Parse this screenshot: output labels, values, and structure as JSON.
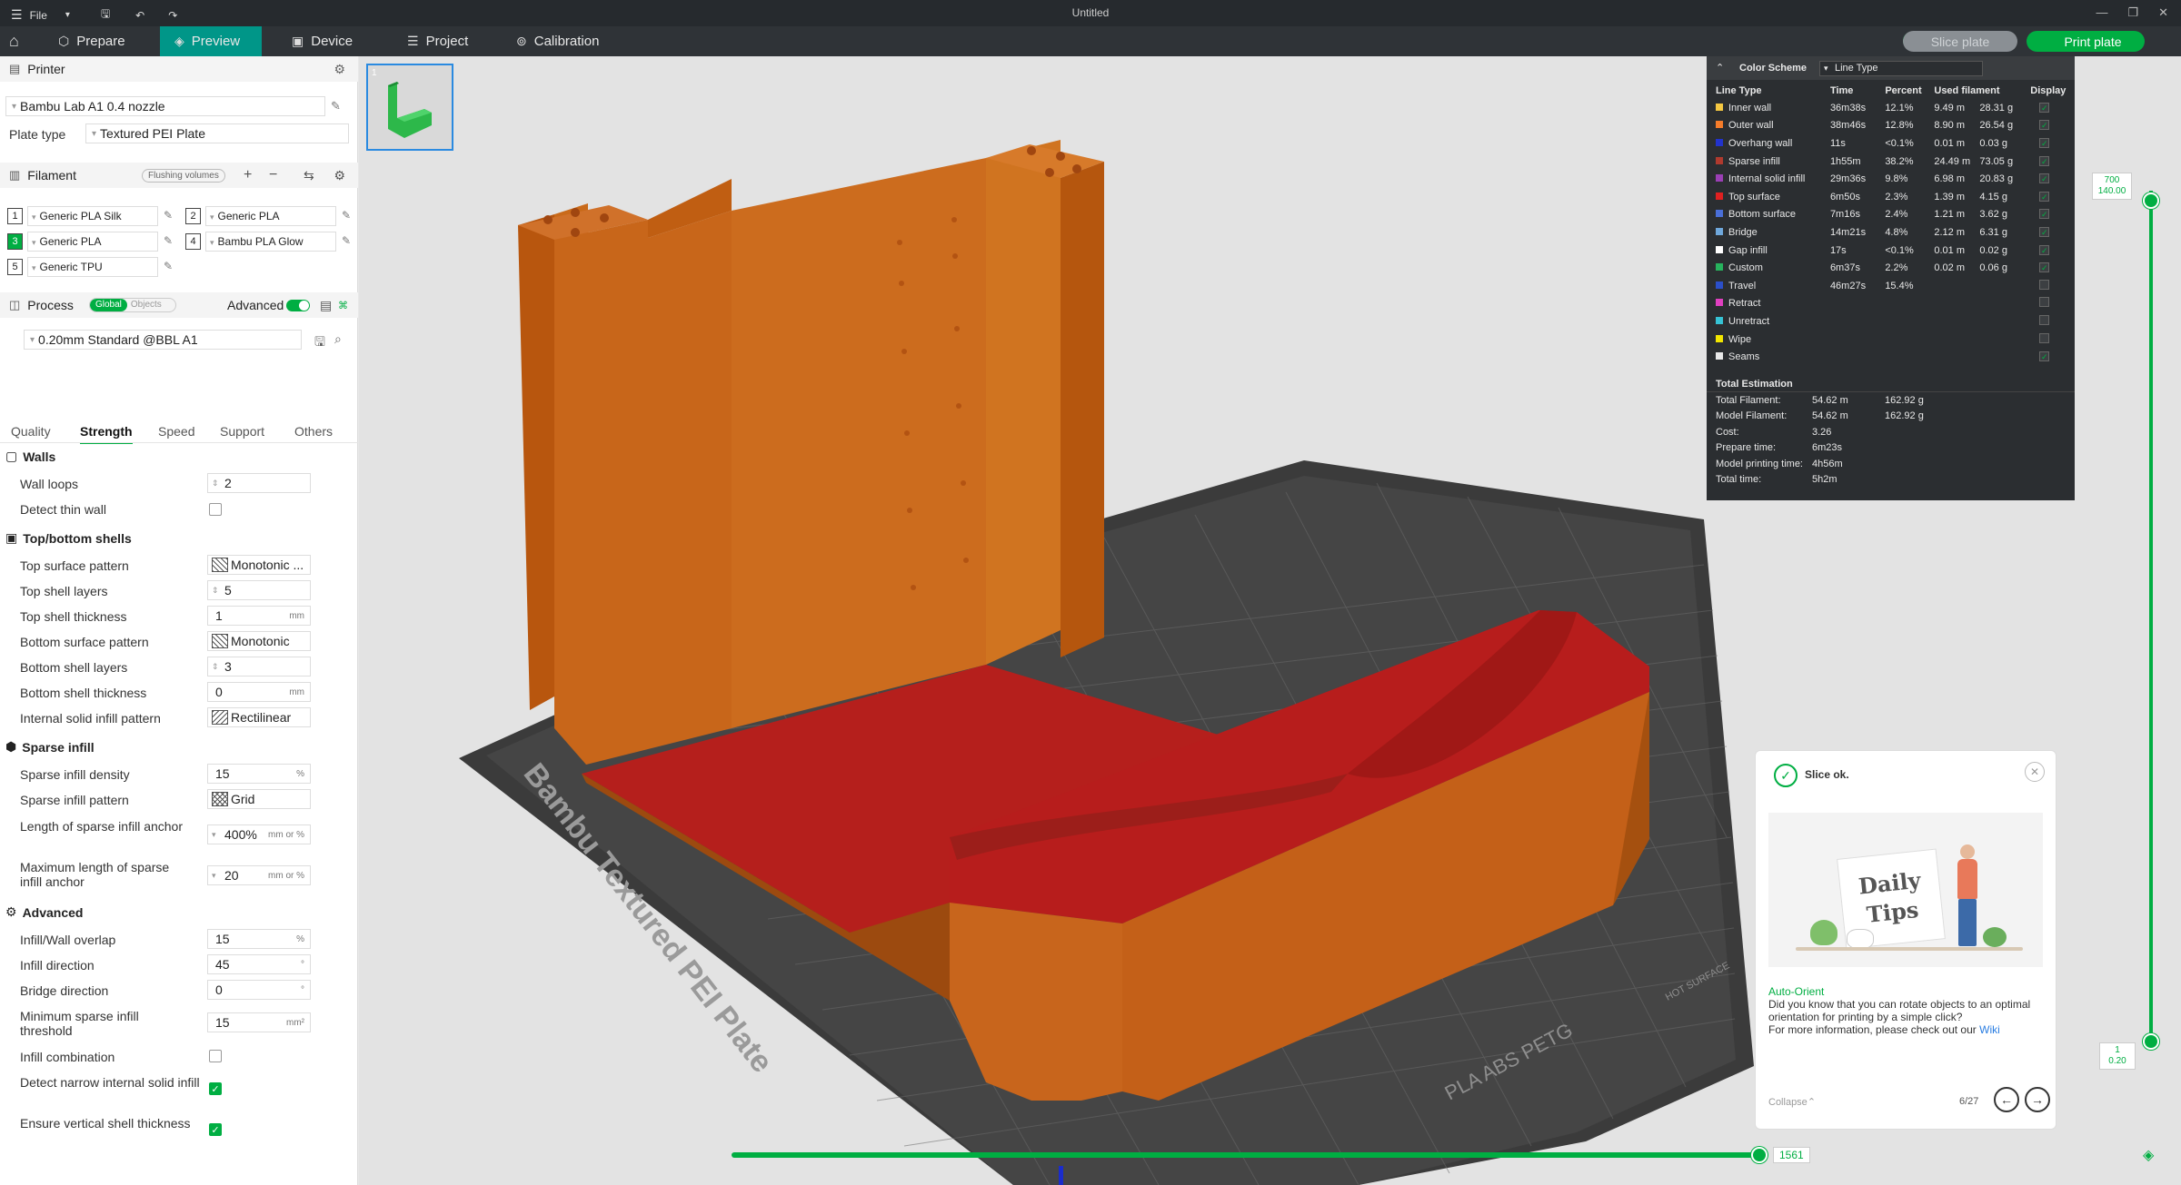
{
  "titlebar": {
    "file_label": "File",
    "title": "Untitled"
  },
  "tabs": [
    {
      "label": "Prepare"
    },
    {
      "label": "Preview"
    },
    {
      "label": "Device"
    },
    {
      "label": "Project"
    },
    {
      "label": "Calibration"
    }
  ],
  "toolbar": {
    "slice_label": "Slice plate",
    "print_label": "Print plate"
  },
  "printer": {
    "section": "Printer",
    "name": "Bambu Lab A1 0.4 nozzle",
    "plate_type_label": "Plate type",
    "plate_type": "Textured PEI Plate"
  },
  "filament": {
    "section": "Filament",
    "flushing_label": "Flushing volumes",
    "slots": [
      {
        "num": "1",
        "name": "Generic PLA Silk",
        "color": "#ffffff"
      },
      {
        "num": "2",
        "name": "Generic PLA",
        "color": "#ffffff"
      },
      {
        "num": "3",
        "name": "Generic PLA",
        "color": "#00ae42"
      },
      {
        "num": "4",
        "name": "Bambu PLA Glow",
        "color": "#ffffff"
      },
      {
        "num": "5",
        "name": "Generic TPU",
        "color": "#ffffff"
      }
    ]
  },
  "process": {
    "section": "Process",
    "global_label": "Global",
    "objects_label": "Objects",
    "advanced_label": "Advanced",
    "preset": "0.20mm Standard @BBL A1",
    "subtabs": [
      "Quality",
      "Strength",
      "Speed",
      "Support",
      "Others"
    ]
  },
  "settings": {
    "walls_title": "Walls",
    "wall_loops_label": "Wall loops",
    "wall_loops": "2",
    "detect_thin_wall_label": "Detect thin wall",
    "topbottom_title": "Top/bottom shells",
    "top_surface_pattern_label": "Top surface pattern",
    "top_surface_pattern": "Monotonic ...",
    "top_shell_layers_label": "Top shell layers",
    "top_shell_layers": "5",
    "top_shell_thickness_label": "Top shell thickness",
    "top_shell_thickness": "1",
    "bottom_surface_pattern_label": "Bottom surface pattern",
    "bottom_surface_pattern": "Monotonic",
    "bottom_shell_layers_label": "Bottom shell layers",
    "bottom_shell_layers": "3",
    "bottom_shell_thickness_label": "Bottom shell thickness",
    "bottom_shell_thickness": "0",
    "internal_solid_label": "Internal solid infill pattern",
    "internal_solid": "Rectilinear",
    "sparse_title": "Sparse infill",
    "sparse_density_label": "Sparse infill density",
    "sparse_density": "15",
    "sparse_pattern_label": "Sparse infill pattern",
    "sparse_pattern": "Grid",
    "anchor_label": "Length of sparse infill anchor",
    "anchor": "400%",
    "max_anchor_label": "Maximum length of sparse infill anchor",
    "max_anchor": "20",
    "advanced_title": "Advanced",
    "overlap_label": "Infill/Wall overlap",
    "overlap": "15",
    "infill_dir_label": "Infill direction",
    "infill_dir": "45",
    "bridge_dir_label": "Bridge direction",
    "bridge_dir": "0",
    "min_sparse_label": "Minimum sparse infill threshold",
    "min_sparse": "15",
    "infill_comb_label": "Infill combination",
    "narrow_label": "Detect narrow internal solid infill",
    "vertical_label": "Ensure vertical shell thickness",
    "unit_mm": "mm",
    "unit_pct": "%",
    "unit_mmpct": "mm or %",
    "unit_deg": "°",
    "unit_mm2": "mm²"
  },
  "legend": {
    "title": "Color Scheme",
    "scheme": "Line Type",
    "headers": [
      "Line Type",
      "Time",
      "Percent",
      "Used filament",
      "Display"
    ],
    "rows": [
      {
        "name": "Inner wall",
        "color": "#f5c842",
        "time": "36m38s",
        "pct": "12.1%",
        "len": "9.49 m",
        "wt": "28.31 g",
        "on": true
      },
      {
        "name": "Outer wall",
        "color": "#f57c2a",
        "time": "38m46s",
        "pct": "12.8%",
        "len": "8.90 m",
        "wt": "26.54 g",
        "on": true
      },
      {
        "name": "Overhang wall",
        "color": "#2233cc",
        "time": "11s",
        "pct": "<0.1%",
        "len": "0.01 m",
        "wt": "0.03 g",
        "on": true
      },
      {
        "name": "Sparse infill",
        "color": "#b03a2e",
        "time": "1h55m",
        "pct": "38.2%",
        "len": "24.49 m",
        "wt": "73.05 g",
        "on": true
      },
      {
        "name": "Internal solid infill",
        "color": "#9b3fb5",
        "time": "29m36s",
        "pct": "9.8%",
        "len": "6.98 m",
        "wt": "20.83 g",
        "on": true
      },
      {
        "name": "Top surface",
        "color": "#e02020",
        "time": "6m50s",
        "pct": "2.3%",
        "len": "1.39 m",
        "wt": "4.15 g",
        "on": true
      },
      {
        "name": "Bottom surface",
        "color": "#4a6fd8",
        "time": "7m16s",
        "pct": "2.4%",
        "len": "1.21 m",
        "wt": "3.62 g",
        "on": true
      },
      {
        "name": "Bridge",
        "color": "#6fa8dc",
        "time": "14m21s",
        "pct": "4.8%",
        "len": "2.12 m",
        "wt": "6.31 g",
        "on": true
      },
      {
        "name": "Gap infill",
        "color": "#ffffff",
        "time": "17s",
        "pct": "<0.1%",
        "len": "0.01 m",
        "wt": "0.02 g",
        "on": true
      },
      {
        "name": "Custom",
        "color": "#27b35d",
        "time": "6m37s",
        "pct": "2.2%",
        "len": "0.02 m",
        "wt": "0.06 g",
        "on": true
      },
      {
        "name": "Travel",
        "color": "#2b4fc9",
        "time": "46m27s",
        "pct": "15.4%",
        "len": "",
        "wt": "",
        "on": false
      },
      {
        "name": "Retract",
        "color": "#e040c0",
        "time": "",
        "pct": "",
        "len": "",
        "wt": "",
        "on": false
      },
      {
        "name": "Unretract",
        "color": "#36c3d4",
        "time": "",
        "pct": "",
        "len": "",
        "wt": "",
        "on": false
      },
      {
        "name": "Wipe",
        "color": "#f2e600",
        "time": "",
        "pct": "",
        "len": "",
        "wt": "",
        "on": false
      },
      {
        "name": "Seams",
        "color": "#e8e8e8",
        "time": "",
        "pct": "",
        "len": "",
        "wt": "",
        "on": true
      }
    ],
    "total_title": "Total Estimation",
    "totals": [
      {
        "k": "Total Filament:",
        "v1": "54.62 m",
        "v2": "162.92 g"
      },
      {
        "k": "Model Filament:",
        "v1": "54.62 m",
        "v2": "162.92 g"
      },
      {
        "k": "Cost:",
        "v1": "3.26",
        "v2": ""
      },
      {
        "k": "Prepare time:",
        "v1": "6m23s",
        "v2": ""
      },
      {
        "k": "Model printing time:",
        "v1": "4h56m",
        "v2": ""
      },
      {
        "k": "Total time:",
        "v1": "5h2m",
        "v2": ""
      }
    ]
  },
  "layer_slider": {
    "top_layer": "700",
    "top_height": "140.00",
    "bottom_layer": "1",
    "bottom_height": "0.20"
  },
  "move_slider": {
    "value": "1561"
  },
  "plate": {
    "name": "Bambu Textured PEI Plate",
    "side_a": "PLA ABS PETG",
    "side_b": "HOT SURFACE"
  },
  "thumbnail": {
    "index": "1"
  },
  "tips": {
    "status": "Slice ok.",
    "card_title": "Daily Tips",
    "tip_title": "Auto-Orient",
    "tip_body": "Did you know that you can rotate objects to an optimal orientation for printing by a simple click?",
    "tip_more": "For more information, please check out our",
    "wiki": "Wiki",
    "collapse": "Collapse",
    "page": "6/27"
  }
}
